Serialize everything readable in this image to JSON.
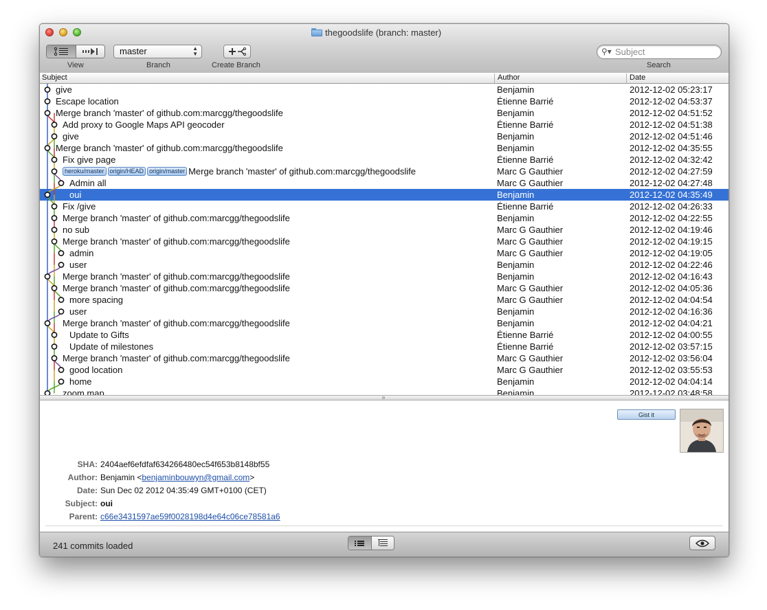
{
  "window": {
    "title": "thegoodslife (branch: master)"
  },
  "toolbar": {
    "view_label": "View",
    "branch_label": "Branch",
    "branch_value": "master",
    "create_branch_label": "Create Branch",
    "search_label": "Search",
    "search_placeholder": "Subject"
  },
  "columns": {
    "subject": "Subject",
    "author": "Author",
    "date": "Date"
  },
  "commits": [
    {
      "subject": "give",
      "author": "Benjamin",
      "date": "2012-12-02 05:23:17",
      "refs": []
    },
    {
      "subject": "Escape location",
      "author": "Étienne Barrié",
      "date": "2012-12-02 04:53:37",
      "refs": []
    },
    {
      "subject": "Merge branch 'master' of github.com:marcgg/thegoodslife",
      "author": "Benjamin",
      "date": "2012-12-02 04:51:52",
      "refs": []
    },
    {
      "subject": "Add proxy to Google Maps API geocoder",
      "author": "Étienne Barrié",
      "date": "2012-12-02 04:51:38",
      "refs": []
    },
    {
      "subject": "give",
      "author": "Benjamin",
      "date": "2012-12-02 04:51:46",
      "refs": []
    },
    {
      "subject": "Merge branch 'master' of github.com:marcgg/thegoodslife",
      "author": "Benjamin",
      "date": "2012-12-02 04:35:55",
      "refs": []
    },
    {
      "subject": "Fix give page",
      "author": "Étienne Barrié",
      "date": "2012-12-02 04:32:42",
      "refs": []
    },
    {
      "subject": "Merge branch 'master' of github.com:marcgg/thegoodslife",
      "author": "Marc G Gauthier",
      "date": "2012-12-02 04:27:59",
      "refs": [
        "heroku/master",
        "origin/HEAD",
        "origin/master"
      ]
    },
    {
      "subject": "Admin all",
      "author": "Marc G Gauthier",
      "date": "2012-12-02 04:27:48",
      "refs": []
    },
    {
      "subject": "oui",
      "author": "Benjamin",
      "date": "2012-12-02 04:35:49",
      "refs": []
    },
    {
      "subject": "Fix /give",
      "author": "Étienne Barrié",
      "date": "2012-12-02 04:26:33",
      "refs": []
    },
    {
      "subject": "Merge branch 'master' of github.com:marcgg/thegoodslife",
      "author": "Benjamin",
      "date": "2012-12-02 04:22:55",
      "refs": []
    },
    {
      "subject": "no sub",
      "author": "Marc G Gauthier",
      "date": "2012-12-02 04:19:46",
      "refs": []
    },
    {
      "subject": "Merge branch 'master' of github.com:marcgg/thegoodslife",
      "author": "Marc G Gauthier",
      "date": "2012-12-02 04:19:15",
      "refs": []
    },
    {
      "subject": "admin",
      "author": "Marc G Gauthier",
      "date": "2012-12-02 04:19:05",
      "refs": []
    },
    {
      "subject": "user",
      "author": "Benjamin",
      "date": "2012-12-02 04:22:46",
      "refs": []
    },
    {
      "subject": "Merge branch 'master' of github.com:marcgg/thegoodslife",
      "author": "Benjamin",
      "date": "2012-12-02 04:16:43",
      "refs": []
    },
    {
      "subject": "Merge branch 'master' of github.com:marcgg/thegoodslife",
      "author": "Marc G Gauthier",
      "date": "2012-12-02 04:05:36",
      "refs": []
    },
    {
      "subject": "more spacing",
      "author": "Marc G Gauthier",
      "date": "2012-12-02 04:04:54",
      "refs": []
    },
    {
      "subject": "user",
      "author": "Benjamin",
      "date": "2012-12-02 04:16:36",
      "refs": []
    },
    {
      "subject": "Merge branch 'master' of github.com:marcgg/thegoodslife",
      "author": "Benjamin",
      "date": "2012-12-02 04:04:21",
      "refs": []
    },
    {
      "subject": "Update to Gifts",
      "author": "Étienne Barrié",
      "date": "2012-12-02 04:00:55",
      "refs": []
    },
    {
      "subject": "Update of milestones",
      "author": "Étienne Barrié",
      "date": "2012-12-02 03:57:15",
      "refs": []
    },
    {
      "subject": "Merge branch 'master' of github.com:marcgg/thegoodslife",
      "author": "Marc G Gauthier",
      "date": "2012-12-02 03:56:04",
      "refs": []
    },
    {
      "subject": "good location",
      "author": "Marc G Gauthier",
      "date": "2012-12-02 03:55:53",
      "refs": []
    },
    {
      "subject": "home",
      "author": "Benjamin",
      "date": "2012-12-02 04:04:14",
      "refs": []
    },
    {
      "subject": "zoom map",
      "author": "Benjamin",
      "date": "2012-12-02 03:48:58",
      "refs": []
    }
  ],
  "selected_index": 9,
  "details": {
    "gist_label": "Gist it",
    "sha_label": "SHA:",
    "sha": "2404aef6efdfaf634266480ec54f653b8148bf55",
    "author_label": "Author:",
    "author_name": "Benjamin <",
    "author_email": "benjaminbouwyn@gmail.com",
    "author_suffix": ">",
    "date_label": "Date:",
    "date": "Sun Dec 02 2012 04:35:49 GMT+0100 (CET)",
    "subject_label": "Subject:",
    "subject": "oui",
    "parent_label": "Parent:",
    "parent": "c66e3431597ae59f0028198d4e64c06ce78581a6"
  },
  "status": {
    "text": "241 commits loaded"
  },
  "colors": {
    "selection": "#3672d5",
    "lane_colors": [
      "#3a66c4",
      "#c9a62c",
      "#58a732",
      "#c23a3a",
      "#7a4fa8"
    ]
  }
}
